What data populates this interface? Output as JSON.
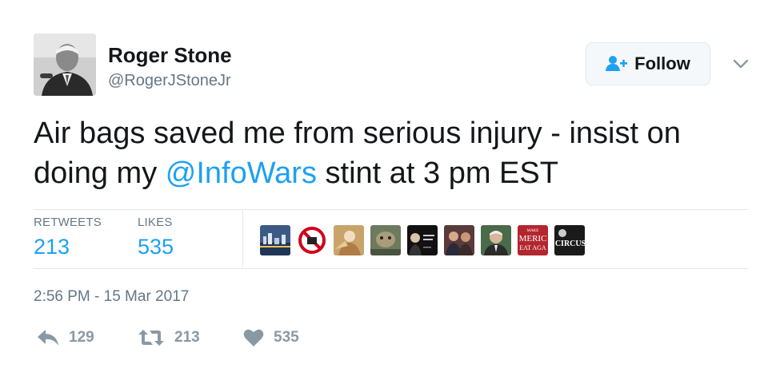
{
  "user": {
    "display_name": "Roger Stone",
    "handle": "@RogerJStoneJr",
    "avatar_icon": "person-photo"
  },
  "follow_button": {
    "label": "Follow",
    "icon": "add-person-icon"
  },
  "menu": {
    "icon": "chevron-down-icon"
  },
  "tweet": {
    "text_before": "Air bags saved me from serious injury - insist on doing my ",
    "mention": "@InfoWars",
    "text_after": " stint at 3 pm EST"
  },
  "stats": {
    "retweets_label": "RETWEETS",
    "retweets_value": "213",
    "likes_label": "LIKES",
    "likes_value": "535"
  },
  "likers": [
    {
      "name": "liker-1",
      "caption": ""
    },
    {
      "name": "liker-2",
      "caption": ""
    },
    {
      "name": "liker-3",
      "caption": ""
    },
    {
      "name": "liker-4",
      "caption": ""
    },
    {
      "name": "liker-5",
      "caption": ""
    },
    {
      "name": "liker-6",
      "caption": ""
    },
    {
      "name": "liker-7",
      "caption": ""
    },
    {
      "name": "liker-8",
      "caption": "MAKE MERIC EAT AGA"
    },
    {
      "name": "liker-9",
      "caption": "CIRCUS"
    }
  ],
  "timestamp": "2:56 PM - 15 Mar 2017",
  "actions": {
    "reply_count": "129",
    "retweet_count": "213",
    "like_count": "535"
  },
  "colors": {
    "accent": "#1da1f2",
    "text": "#14171a",
    "muted": "#657786",
    "action_gray": "#8899a6",
    "border": "#e1e8ed"
  }
}
